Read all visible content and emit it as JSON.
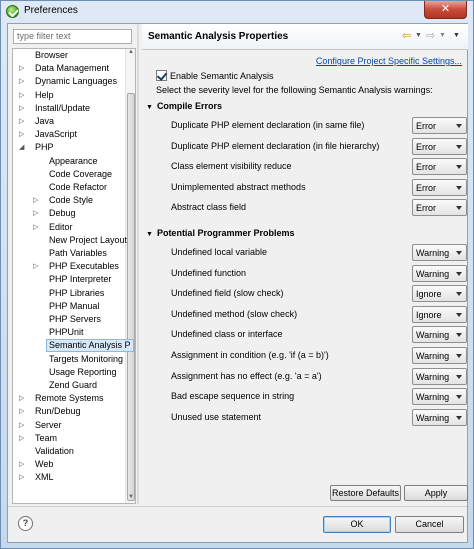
{
  "window": {
    "title": "Preferences",
    "close_glyph": "✕"
  },
  "filter": {
    "placeholder": "type filter text"
  },
  "tree": {
    "items": [
      {
        "label": "Browser",
        "level": 0,
        "expandable": false,
        "expanded": false
      },
      {
        "label": "Data Management",
        "level": 0,
        "expandable": true,
        "expanded": false
      },
      {
        "label": "Dynamic Languages",
        "level": 0,
        "expandable": true,
        "expanded": false
      },
      {
        "label": "Help",
        "level": 0,
        "expandable": true,
        "expanded": false
      },
      {
        "label": "Install/Update",
        "level": 0,
        "expandable": true,
        "expanded": false
      },
      {
        "label": "Java",
        "level": 0,
        "expandable": true,
        "expanded": false
      },
      {
        "label": "JavaScript",
        "level": 0,
        "expandable": true,
        "expanded": false
      },
      {
        "label": "PHP",
        "level": 0,
        "expandable": true,
        "expanded": true
      },
      {
        "label": "Appearance",
        "level": 1,
        "expandable": false,
        "expanded": false
      },
      {
        "label": "Code Coverage",
        "level": 1,
        "expandable": false,
        "expanded": false
      },
      {
        "label": "Code Refactor",
        "level": 1,
        "expandable": false,
        "expanded": false
      },
      {
        "label": "Code Style",
        "level": 1,
        "expandable": true,
        "expanded": false
      },
      {
        "label": "Debug",
        "level": 1,
        "expandable": true,
        "expanded": false
      },
      {
        "label": "Editor",
        "level": 1,
        "expandable": true,
        "expanded": false
      },
      {
        "label": "New Project Layout",
        "level": 1,
        "expandable": false,
        "expanded": false
      },
      {
        "label": "Path Variables",
        "level": 1,
        "expandable": false,
        "expanded": false
      },
      {
        "label": "PHP Executables",
        "level": 1,
        "expandable": true,
        "expanded": false
      },
      {
        "label": "PHP Interpreter",
        "level": 1,
        "expandable": false,
        "expanded": false
      },
      {
        "label": "PHP Libraries",
        "level": 1,
        "expandable": false,
        "expanded": false
      },
      {
        "label": "PHP Manual",
        "level": 1,
        "expandable": false,
        "expanded": false
      },
      {
        "label": "PHP Servers",
        "level": 1,
        "expandable": false,
        "expanded": false
      },
      {
        "label": "PHPUnit",
        "level": 1,
        "expandable": false,
        "expanded": false
      },
      {
        "label": "Semantic Analysis P",
        "level": 1,
        "expandable": false,
        "expanded": false,
        "selected": true
      },
      {
        "label": "Targets Monitoring",
        "level": 1,
        "expandable": false,
        "expanded": false
      },
      {
        "label": "Usage Reporting",
        "level": 1,
        "expandable": false,
        "expanded": false
      },
      {
        "label": "Zend Guard",
        "level": 1,
        "expandable": false,
        "expanded": false
      },
      {
        "label": "Remote Systems",
        "level": 0,
        "expandable": true,
        "expanded": false
      },
      {
        "label": "Run/Debug",
        "level": 0,
        "expandable": true,
        "expanded": false
      },
      {
        "label": "Server",
        "level": 0,
        "expandable": true,
        "expanded": false
      },
      {
        "label": "Team",
        "level": 0,
        "expandable": true,
        "expanded": false
      },
      {
        "label": "Validation",
        "level": 0,
        "expandable": false,
        "expanded": false
      },
      {
        "label": "Web",
        "level": 0,
        "expandable": true,
        "expanded": false
      },
      {
        "label": "XML",
        "level": 0,
        "expandable": true,
        "expanded": false
      }
    ]
  },
  "page": {
    "title": "Semantic Analysis Properties",
    "configure_link": "Configure Project Specific Settings...",
    "enable_label": "Enable Semantic Analysis",
    "enable_checked": true,
    "description": "Select the severity level for the following Semantic Analysis warnings:",
    "sections": [
      {
        "title": "Compile Errors",
        "rules": [
          {
            "label": "Duplicate PHP element declaration (in same file)",
            "value": "Error"
          },
          {
            "label": "Duplicate PHP element declaration (in file hierarchy)",
            "value": "Error"
          },
          {
            "label": "Class element visibility reduce",
            "value": "Error"
          },
          {
            "label": "Unimplemented abstract methods",
            "value": "Error"
          },
          {
            "label": "Abstract class field",
            "value": "Error"
          }
        ]
      },
      {
        "title": "Potential Programmer Problems",
        "rules": [
          {
            "label": "Undefined local variable",
            "value": "Warning"
          },
          {
            "label": "Undefined function",
            "value": "Warning"
          },
          {
            "label": "Undefined field (slow check)",
            "value": "Ignore"
          },
          {
            "label": "Undefined method (slow check)",
            "value": "Ignore"
          },
          {
            "label": "Undefined class or interface",
            "value": "Warning"
          },
          {
            "label": "Assignment in condition (e.g. 'if (a = b)')",
            "value": "Warning"
          },
          {
            "label": "Assignment has no effect (e.g. 'a = a')",
            "value": "Warning"
          },
          {
            "label": "Bad escape sequence in string",
            "value": "Warning"
          },
          {
            "label": "Unused use statement",
            "value": "Warning"
          }
        ]
      }
    ],
    "restore_defaults_label": "Restore Defaults",
    "apply_label": "Apply"
  },
  "footer": {
    "help_glyph": "?",
    "ok_label": "OK",
    "cancel_label": "Cancel"
  },
  "icons": {
    "app": "eclipse-icon",
    "back": "back-arrow-icon",
    "forward": "forward-arrow-icon",
    "view_menu": "view-menu-icon"
  }
}
